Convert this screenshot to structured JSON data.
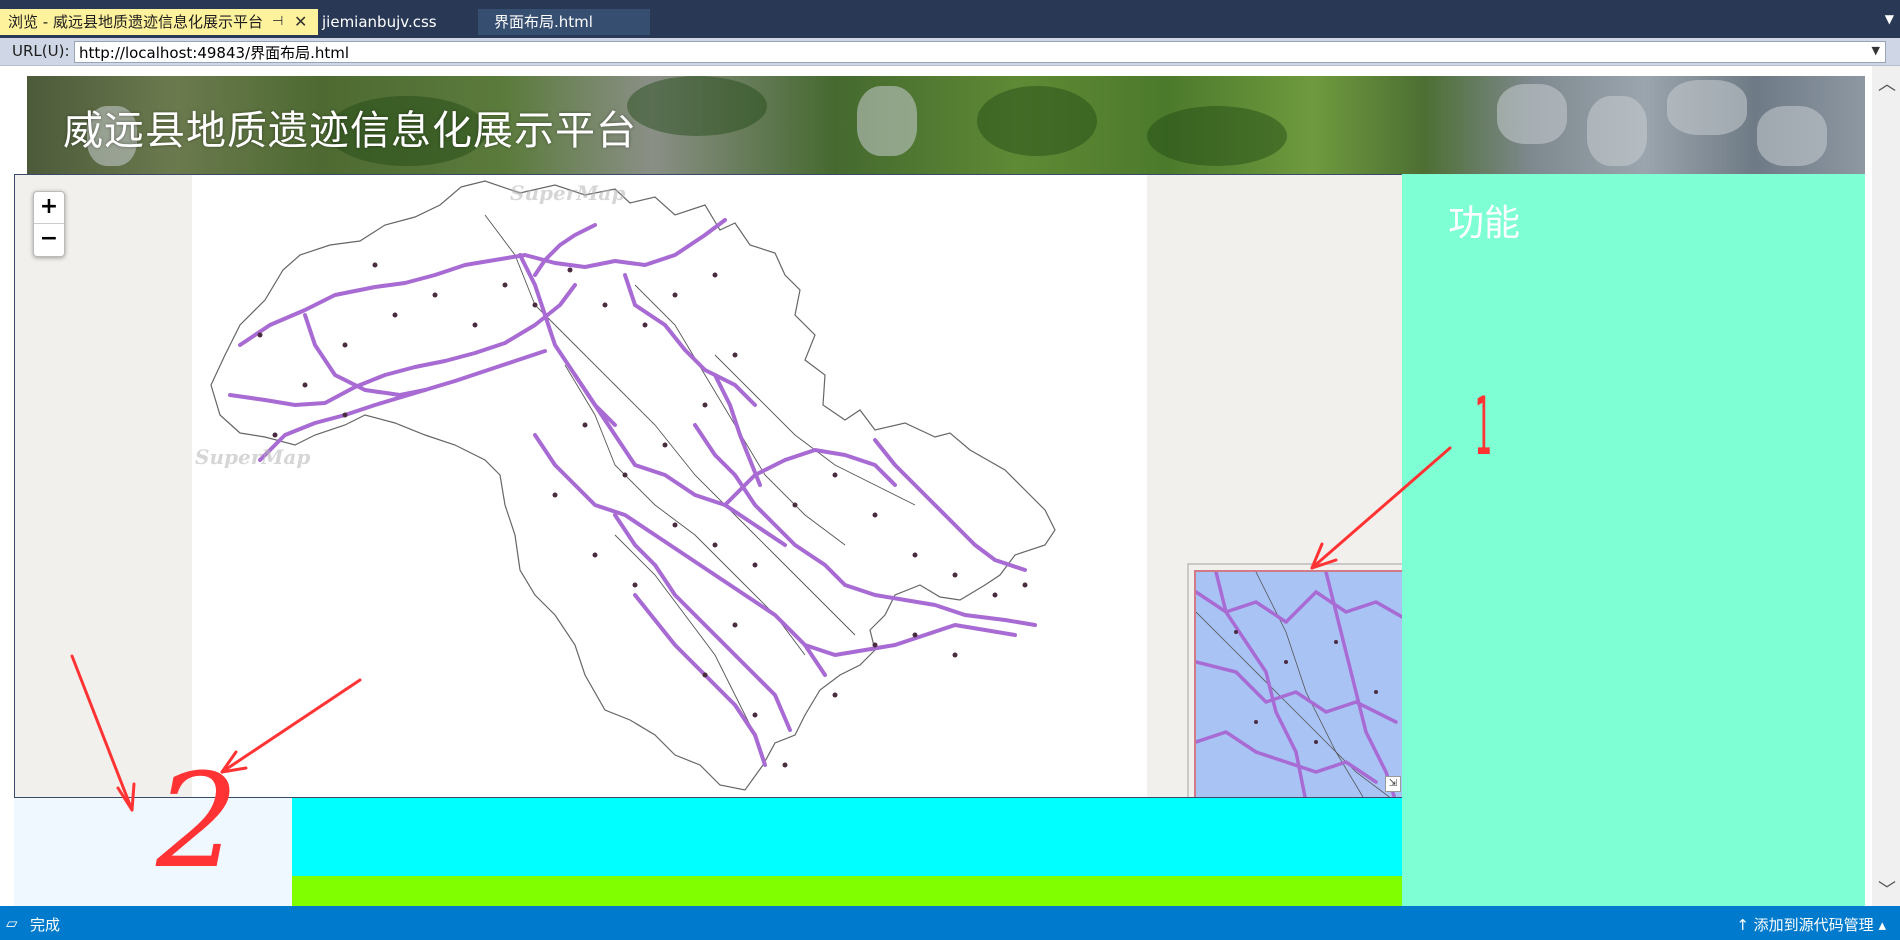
{
  "tabs": [
    {
      "label": "浏览 - 威远县地质遗迹信息化展示平台",
      "pin": "⊣",
      "close": "✕"
    },
    {
      "label": "jiemianbujv.css"
    },
    {
      "label": "界面布局.html"
    }
  ],
  "urlbar": {
    "label": "URL(U):",
    "value": "http://localhost:49843/界面布局.html"
  },
  "page": {
    "site_title": "威远县地质遗迹信息化展示平台",
    "function_title": "功能",
    "watermark": "SuperMap",
    "zoom_in": "+",
    "zoom_out": "−"
  },
  "annotations": {
    "mark1": "1",
    "mark2": "2"
  },
  "status": {
    "text": "完成",
    "source_control": "添加到源代码管理"
  },
  "icons": {
    "status": "status-square-icon",
    "source_control": "arrow-up-icon"
  },
  "colors": {
    "tab_active": "#fff29d",
    "function_panel": "#7fffd4",
    "cyan_panel": "#00ffff",
    "green_panel": "#7fff00",
    "left_bottom_panel": "#f0f8ff",
    "route_purple": "#a86bd3",
    "annotation_red": "#ff3333",
    "statusbar": "#007acc"
  }
}
